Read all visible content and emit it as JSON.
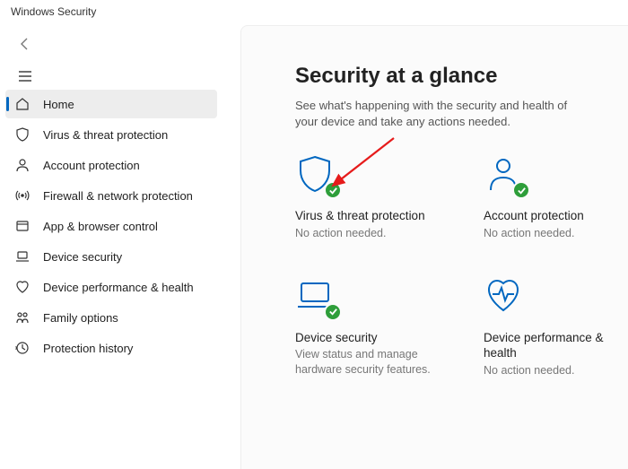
{
  "app_title": "Windows Security",
  "sidebar": {
    "items": [
      {
        "label": "Home"
      },
      {
        "label": "Virus & threat protection"
      },
      {
        "label": "Account protection"
      },
      {
        "label": "Firewall & network protection"
      },
      {
        "label": "App & browser control"
      },
      {
        "label": "Device security"
      },
      {
        "label": "Device performance & health"
      },
      {
        "label": "Family options"
      },
      {
        "label": "Protection history"
      }
    ]
  },
  "main": {
    "title": "Security at a glance",
    "subtitle": "See what's happening with the security and health of your device and take any actions needed.",
    "cards": [
      {
        "title": "Virus & threat protection",
        "status": "No action needed."
      },
      {
        "title": "Account protection",
        "status": "No action needed."
      },
      {
        "title": "Device security",
        "status": "View status and manage hardware security features."
      },
      {
        "title": "Device performance & health",
        "status": "No action needed."
      }
    ]
  }
}
